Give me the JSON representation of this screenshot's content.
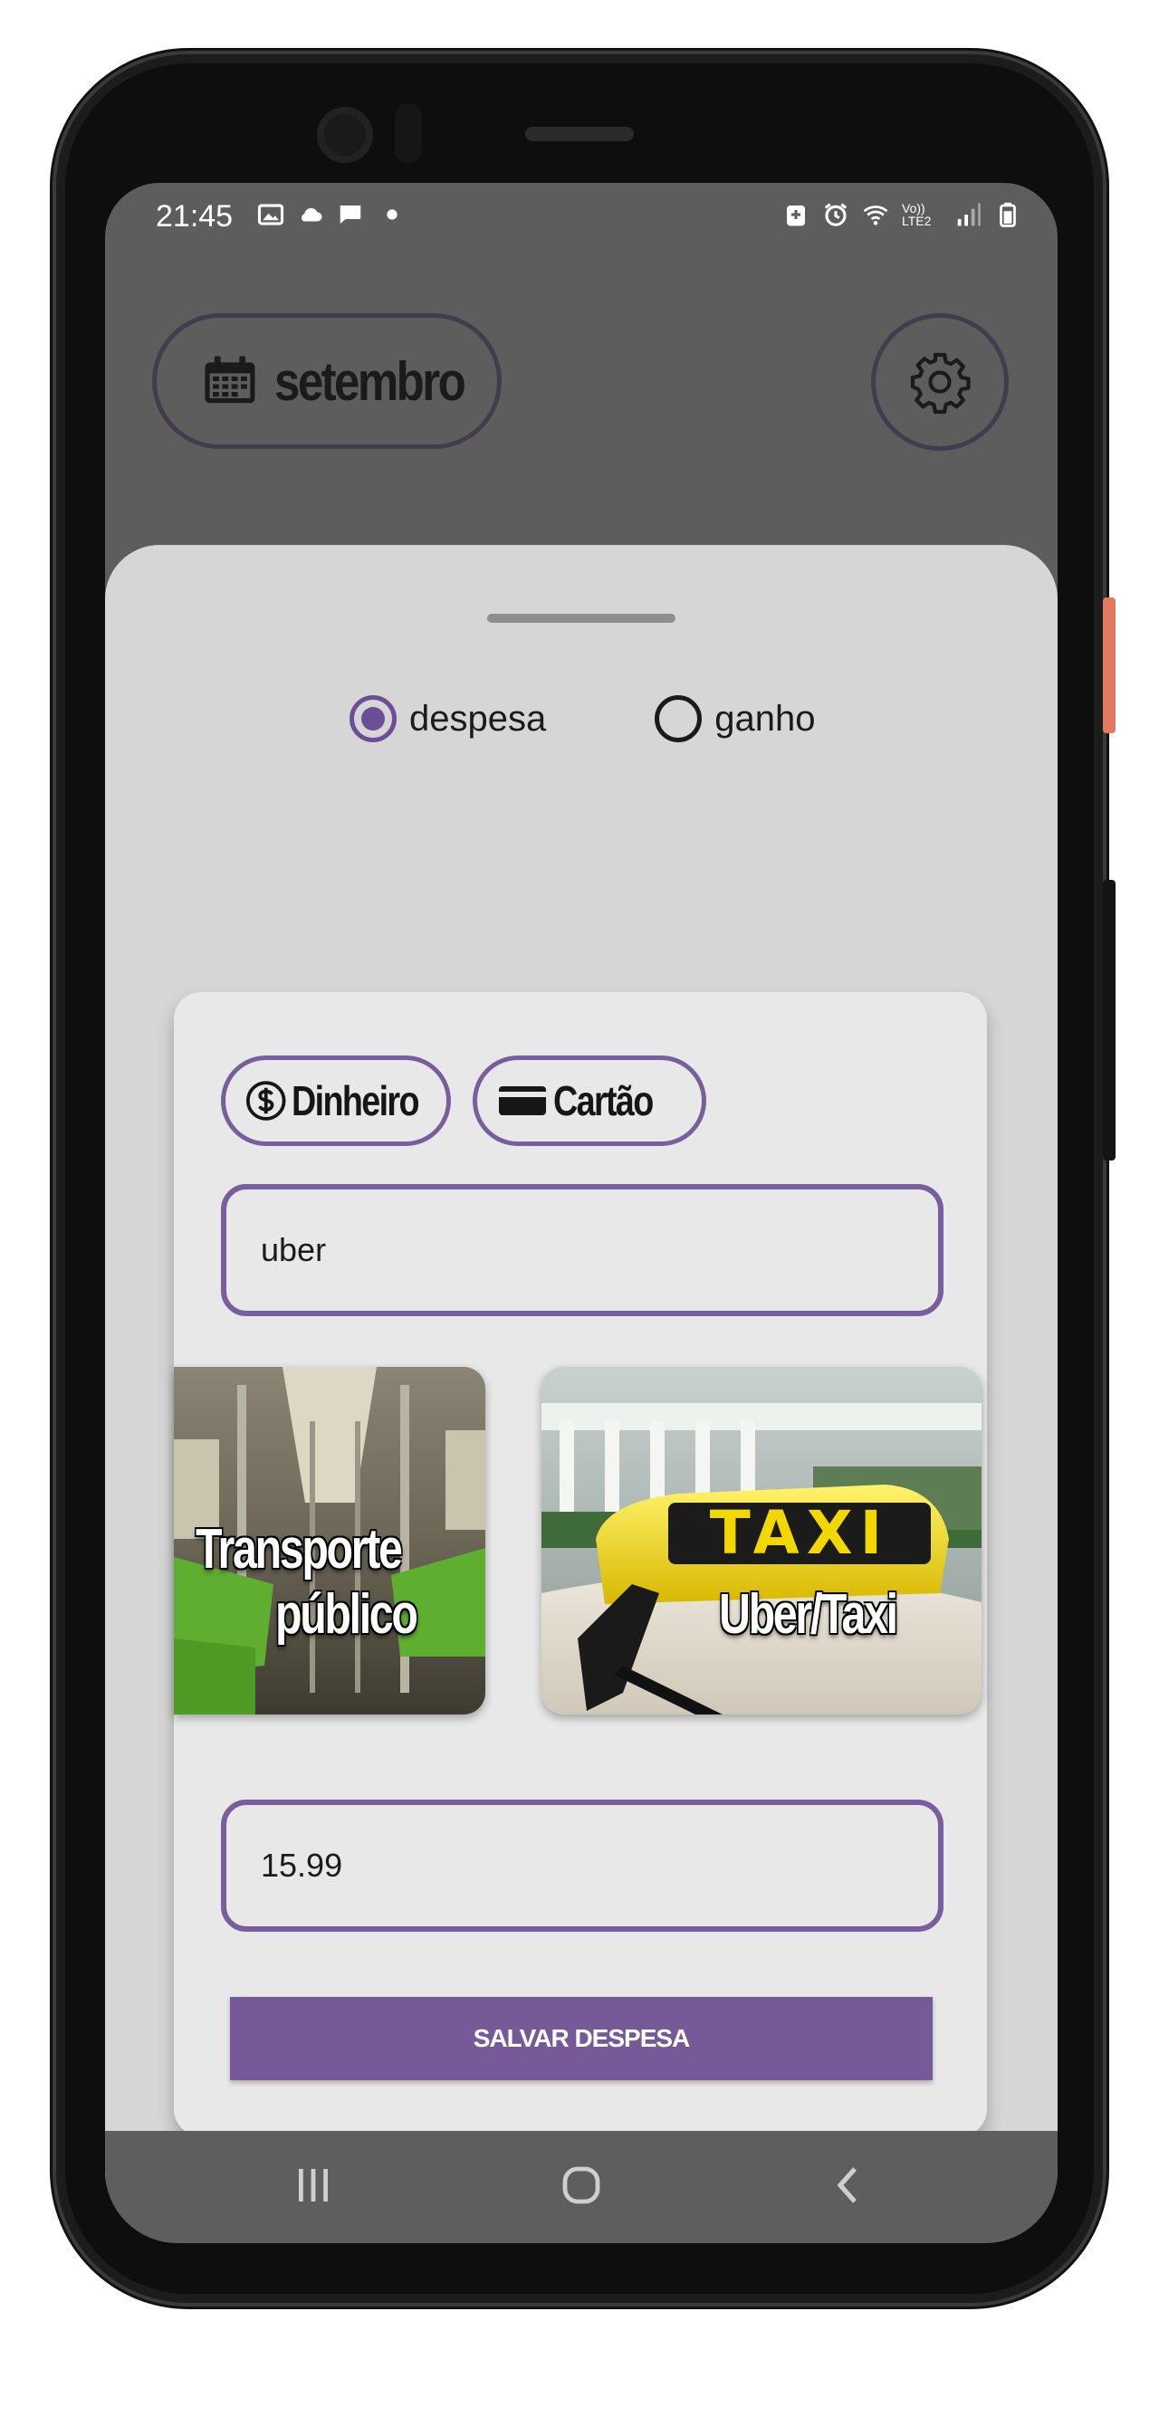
{
  "status_bar": {
    "time": "21:45",
    "left_icons": [
      "image-icon",
      "cloud-icon",
      "chat-icon",
      "dot-icon"
    ],
    "right_icons": [
      "battery-saver-icon",
      "alarm-icon",
      "wifi-icon",
      "volte-icon",
      "signal-icon",
      "battery-icon"
    ],
    "volte_label": "Vo)) LTE2"
  },
  "header": {
    "month_label": "setembro",
    "calendar_icon": "calendar-icon",
    "settings_icon": "gear-icon"
  },
  "type_selector": {
    "options": [
      {
        "label": "despesa",
        "selected": true
      },
      {
        "label": "ganho",
        "selected": false
      }
    ]
  },
  "payment_methods": {
    "cash_label": "Dinheiro",
    "card_label": "Cartão"
  },
  "form": {
    "description_value": "uber",
    "amount_value": "15.99",
    "save_label": "SALVAR DESPESA"
  },
  "categories": [
    {
      "label_line1": "Transporte",
      "label_line2": "público",
      "image": "subway-interior"
    },
    {
      "label": "Uber/Taxi",
      "sign_text": "TAXI",
      "image": "taxi-sign"
    }
  ],
  "nav_bar": {
    "items": [
      "recent-apps-icon",
      "home-icon",
      "back-icon"
    ]
  },
  "colors": {
    "accent": "#765a98",
    "outline": "#785e9c",
    "app_background": "#5d5d5d",
    "sheet_background": "#d6d6d6",
    "card_background": "#e8e8e8"
  }
}
